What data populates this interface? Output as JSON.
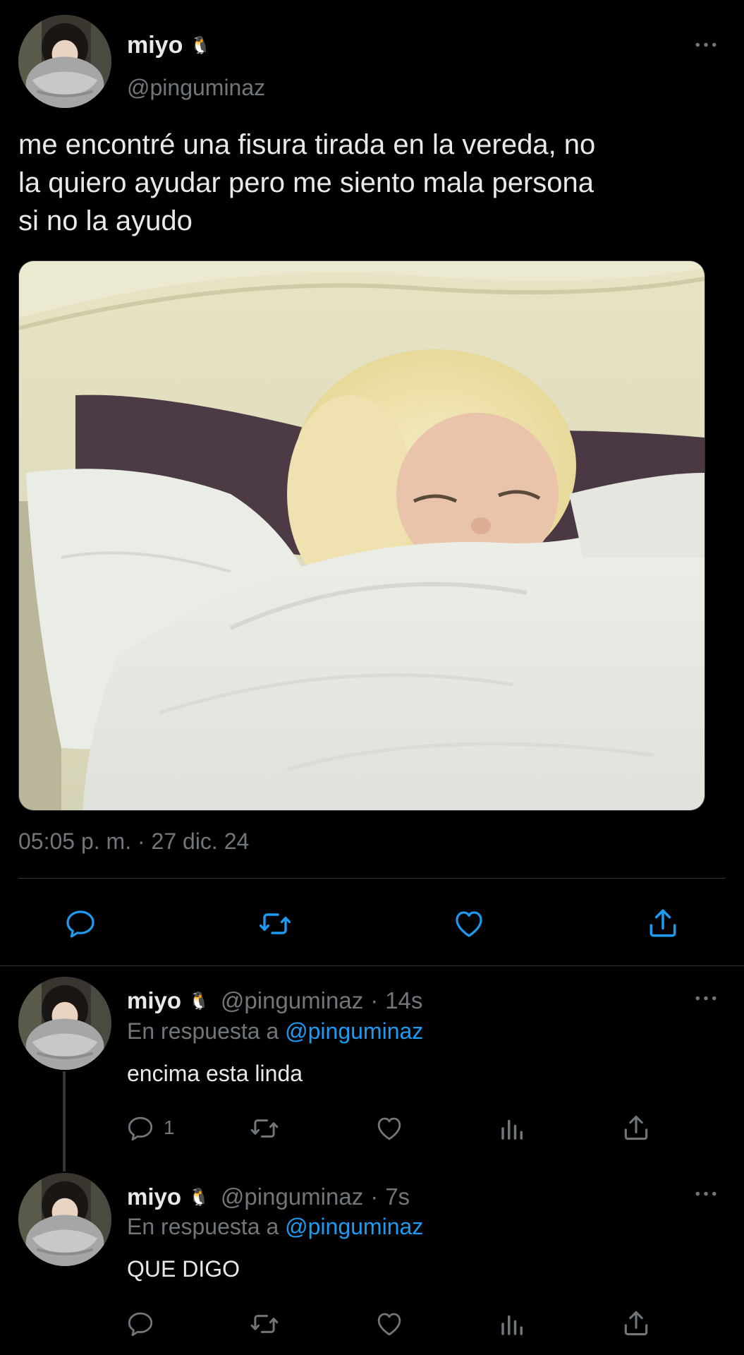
{
  "main_tweet": {
    "display_name": "miyo",
    "name_emoji": "🐧",
    "handle": "@pinguminaz",
    "text_lines": [
      "me encontré una fisura tirada en la vereda, no",
      "la quiero ayudar pero me siento mala persona",
      "si no la ayudo"
    ],
    "timestamp": "05:05 p. m. · 27 dic. 24",
    "actions": [
      "reply-icon",
      "retweet-icon",
      "like-icon",
      "share-icon"
    ]
  },
  "replies": [
    {
      "display_name": "miyo",
      "name_emoji": "🐧",
      "handle": "@pinguminaz",
      "separator": "·",
      "time": "14s",
      "reply_prefix": "En respuesta a",
      "reply_to": "@pinguminaz",
      "text": "encima esta linda",
      "reply_count": "1"
    },
    {
      "display_name": "miyo",
      "name_emoji": "🐧",
      "handle": "@pinguminaz",
      "separator": "·",
      "time": "7s",
      "reply_prefix": "En respuesta a",
      "reply_to": "@pinguminaz",
      "text": "QUE DIGO",
      "reply_count": ""
    }
  ],
  "colors": {
    "background": "#000000",
    "text": "#e7e9ea",
    "secondary": "#71767b",
    "link": "#1d9bf0",
    "divider": "#2f3336"
  }
}
